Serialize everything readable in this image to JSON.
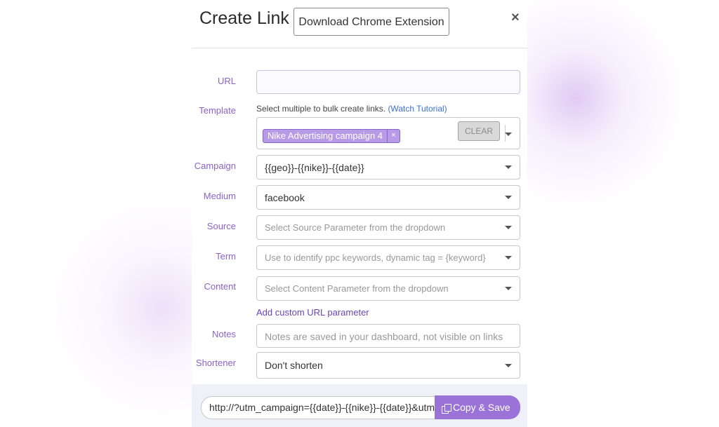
{
  "header": {
    "title": "Create Link",
    "extension_button": "Download Chrome Extension",
    "close": "×"
  },
  "form": {
    "url": {
      "label": "URL",
      "value": ""
    },
    "template": {
      "label": "Template",
      "hint": "Select multiple to bulk create links.",
      "hint_link": "(Watch Tutorial)",
      "tag": "Nike Advertising campaign 4",
      "tag_remove": "×",
      "clear_label": "CLEAR"
    },
    "campaign": {
      "label": "Campaign",
      "value": "{{geo}}-{{nike}}-{{date}}"
    },
    "medium": {
      "label": "Medium",
      "value": "facebook"
    },
    "source": {
      "label": "Source",
      "placeholder": "Select Source Parameter from the dropdown"
    },
    "term": {
      "label": "Term",
      "placeholder": "Use to identify ppc keywords, dynamic tag = {keyword}"
    },
    "content": {
      "label": "Content",
      "placeholder": "Select Content Parameter from the dropdown"
    },
    "add_param": "Add custom URL parameter",
    "notes": {
      "label": "Notes",
      "placeholder": "Notes are saved in your dashboard, not visible on links"
    },
    "shortener": {
      "label": "Shortener",
      "value": "Don't shorten"
    }
  },
  "footer": {
    "result_url": "http://?utm_campaign={{date}}-{{nike}}-{{date}}&utm_medium=facebook",
    "copy_save_label": "Copy & Save"
  },
  "colors": {
    "accent": "#9a72d8",
    "label": "#8a62c8",
    "tag": "#b79be6",
    "link": "#3b6fd8"
  }
}
